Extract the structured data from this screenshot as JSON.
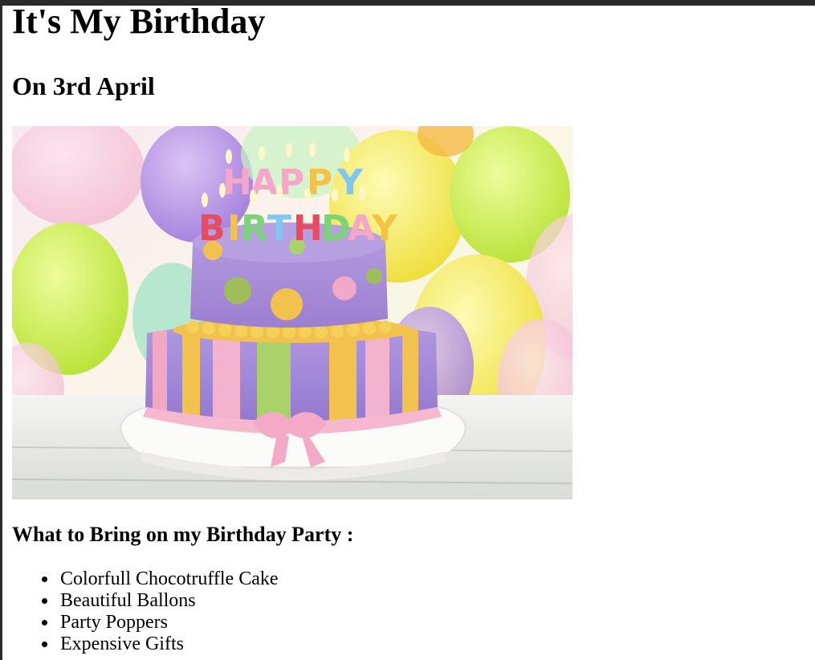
{
  "page": {
    "title": "It's My Birthday",
    "subtitle": "On 3rd April",
    "image": {
      "icon": "birthday-cake-photo",
      "candle_text_line1": "HAPPY",
      "candle_text_line2": "BIRTHDAY",
      "colors": {
        "cake_top": "#a98fd6",
        "cake_stripe_yellow": "#f2c24f",
        "cake_stripe_green": "#a9d36a",
        "cake_stripe_pink": "#f2a7c4",
        "ribbon": "#f6b8cf",
        "balloon_green": "#c9ee3f",
        "balloon_purple": "#b58ee6",
        "balloon_yellow": "#f6e64a"
      }
    },
    "section_heading": "What to Bring on my Birthday Party :",
    "items": [
      "Colorfull Chocotruffle Cake",
      "Beautiful Ballons",
      "Party Poppers",
      "Expensive Gifts"
    ]
  }
}
